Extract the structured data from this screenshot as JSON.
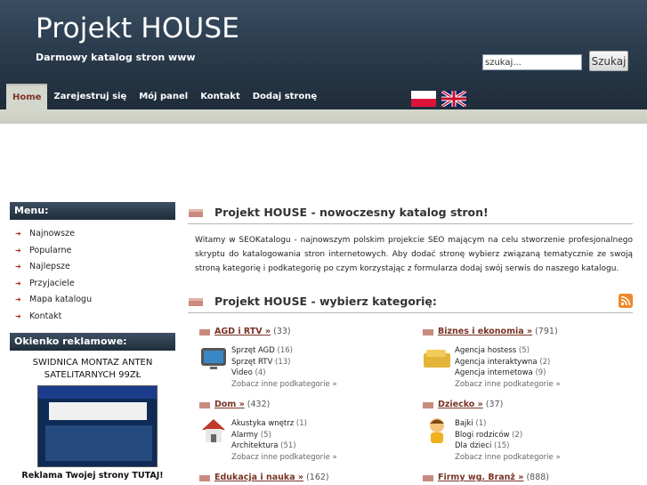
{
  "header": {
    "title": "Projekt HOUSE",
    "subtitle": "Darmowy katalog stron www",
    "search_placeholder": "szukaj...",
    "search_button": "Szukaj"
  },
  "nav": {
    "items": [
      {
        "label": "Home"
      },
      {
        "label": "Zarejestruj się"
      },
      {
        "label": "Mój panel"
      },
      {
        "label": "Kontakt"
      },
      {
        "label": "Dodaj stronę"
      }
    ]
  },
  "sidebar": {
    "menu_title": "Menu:",
    "menu": [
      "Najnowsze",
      "Popularne",
      "Najlepsze",
      "Przyjaciele",
      "Mapa katalogu",
      "Kontakt"
    ],
    "ad_title": "Okienko reklamowe:",
    "ad_text": "SWIDNICA MONTAZ ANTEN SATELITARNYCH 99ZŁ",
    "ad_footer": "Reklama Twojej strony TUTAJ!"
  },
  "main": {
    "intro_title": "Projekt HOUSE - nowoczesny katalog stron!",
    "intro_text": "Witamy w SEOKatalogu - najnowszym polskim projekcie SEO mającym na celu stworzenie profesjonalnego skryptu do katalogowania stron internetowych. Aby dodać stronę wybierz związaną tematycznie ze swoją stroną kategorię i podkategorię po czym korzystając z formularza dodaj swój serwis do naszego katalogu.",
    "cat_title": "Projekt HOUSE - wybierz kategorię:",
    "more_label": "Zobacz inne podkategorie »",
    "categories": [
      {
        "name": "AGD i RTV »",
        "count": "(33)",
        "subs": [
          [
            "Sprzęt AGD",
            "(16)"
          ],
          [
            "Sprzęt RTV",
            "(13)"
          ],
          [
            "Video",
            "(4)"
          ]
        ]
      },
      {
        "name": "Biznes i ekonomia »",
        "count": "(791)",
        "subs": [
          [
            "Agencja hostess",
            "(5)"
          ],
          [
            "Agencja interaktywna",
            "(2)"
          ],
          [
            "Agencja internetowa",
            "(9)"
          ]
        ]
      },
      {
        "name": "Dom »",
        "count": "(432)",
        "subs": [
          [
            "Akustyka wnętrz",
            "(1)"
          ],
          [
            "Alarmy",
            "(5)"
          ],
          [
            "Architektura",
            "(51)"
          ]
        ]
      },
      {
        "name": "Dziecko »",
        "count": "(37)",
        "subs": [
          [
            "Bajki",
            "(1)"
          ],
          [
            "Blogi rodziców",
            "(2)"
          ],
          [
            "Dla dzieci",
            "(15)"
          ]
        ]
      },
      {
        "name": "Edukacja i nauka »",
        "count": "(162)",
        "subs": []
      },
      {
        "name": "Firmy wg. Branż »",
        "count": "(888)",
        "subs": []
      }
    ]
  },
  "colors": {
    "header_dark": "#1f2c3a",
    "accent": "#7a3326",
    "nav_active_bg": "#d4d7cc"
  }
}
